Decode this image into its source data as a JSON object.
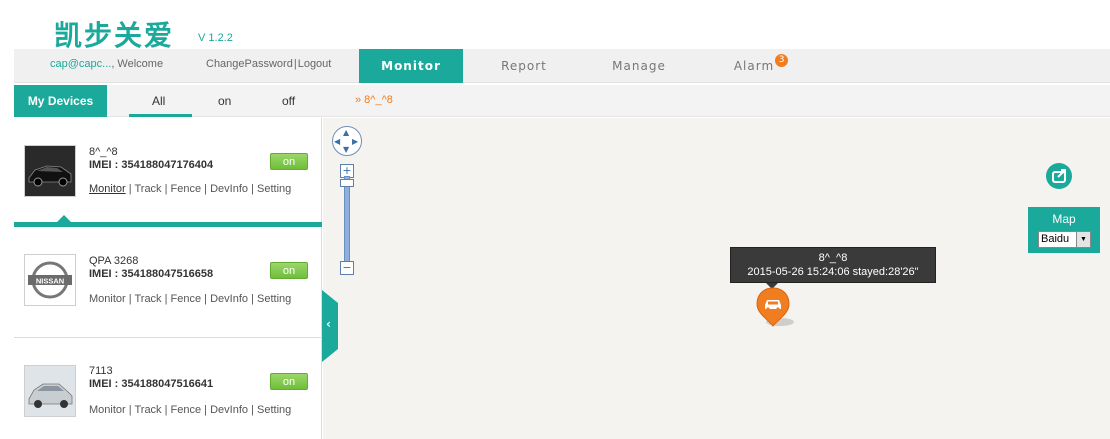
{
  "header": {
    "logo_text": "凯步关爱",
    "version": "V 1.2.2",
    "user_email": "cap@capc...",
    "welcome": ", Welcome",
    "change_password": "ChangePassword",
    "logout": "Logout",
    "tabs": [
      {
        "label": "Monitor",
        "active": true
      },
      {
        "label": "Report",
        "active": false
      },
      {
        "label": "Manage",
        "active": false
      },
      {
        "label": "Alarm",
        "active": false
      }
    ],
    "alarm_count": "3"
  },
  "subbar": {
    "my_devices": "My Devices",
    "filters": [
      "All",
      "on",
      "off"
    ],
    "selected_filter": "All",
    "breadcrumb": "» 8^_^8"
  },
  "devices": [
    {
      "name": "8^_^8",
      "imei": "IMEI : 354188047176404",
      "status": "on",
      "actions": [
        "Monitor",
        "Track",
        "Fence",
        "DevInfo",
        "Setting"
      ],
      "selected": true,
      "thumb": "black-car-icon"
    },
    {
      "name": "QPA 3268",
      "imei": "IMEI : 354188047516658",
      "status": "on",
      "actions": [
        "Monitor",
        "Track",
        "Fence",
        "DevInfo",
        "Setting"
      ],
      "selected": false,
      "thumb": "nissan-logo-icon"
    },
    {
      "name": "7113",
      "imei": "IMEI : 354188047516641",
      "status": "on",
      "actions": [
        "Monitor",
        "Track",
        "Fence",
        "DevInfo",
        "Setting"
      ],
      "selected": false,
      "thumb": "silver-car-icon"
    }
  ],
  "map": {
    "tooltip_title": "8^_^8",
    "tooltip_detail": "2015-05-26 15:24:06 stayed:28'26\"",
    "map_label": "Map",
    "provider": "Baidu",
    "zoom_in": "+",
    "zoom_out": "−"
  },
  "colors": {
    "accent": "#1aa99a",
    "orange": "#f07d1f",
    "status_on": "#6fbf3a"
  }
}
